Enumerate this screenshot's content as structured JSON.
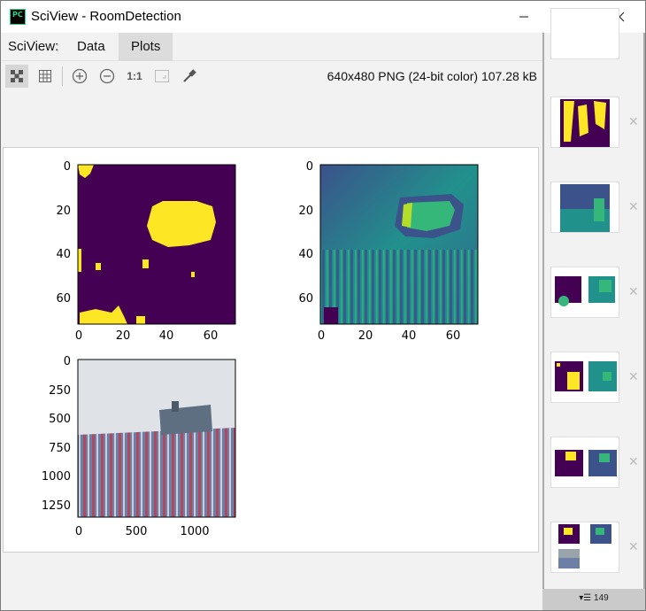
{
  "window": {
    "title": "SciView - RoomDetection",
    "icon_label": "PC"
  },
  "menu": {
    "prefix": "SciView:",
    "tabs": [
      {
        "label": "Data"
      },
      {
        "label": "Plots"
      }
    ]
  },
  "toolbar": {
    "image_info": "640x480 PNG (24-bit color) 107.28 kB",
    "actual_size_label": "1:1"
  },
  "plots": {
    "mask": {
      "y_ticks": [
        "0",
        "20",
        "40",
        "60"
      ],
      "x_ticks": [
        "0",
        "20",
        "40",
        "60"
      ]
    },
    "depth": {
      "y_ticks": [
        "0",
        "20",
        "40",
        "60"
      ],
      "x_ticks": [
        "0",
        "20",
        "40",
        "60"
      ]
    },
    "photo": {
      "y_ticks": [
        "0",
        "250",
        "500",
        "750",
        "1000",
        "1250"
      ],
      "x_ticks": [
        "0",
        "500",
        "1000"
      ]
    }
  },
  "sidebar": {
    "count_label": "149"
  },
  "colors": {
    "viridis_dark": "#440154",
    "viridis_yellow": "#fde725",
    "viridis_green": "#35b779",
    "viridis_teal": "#21918c",
    "viridis_blue": "#3b528b"
  }
}
